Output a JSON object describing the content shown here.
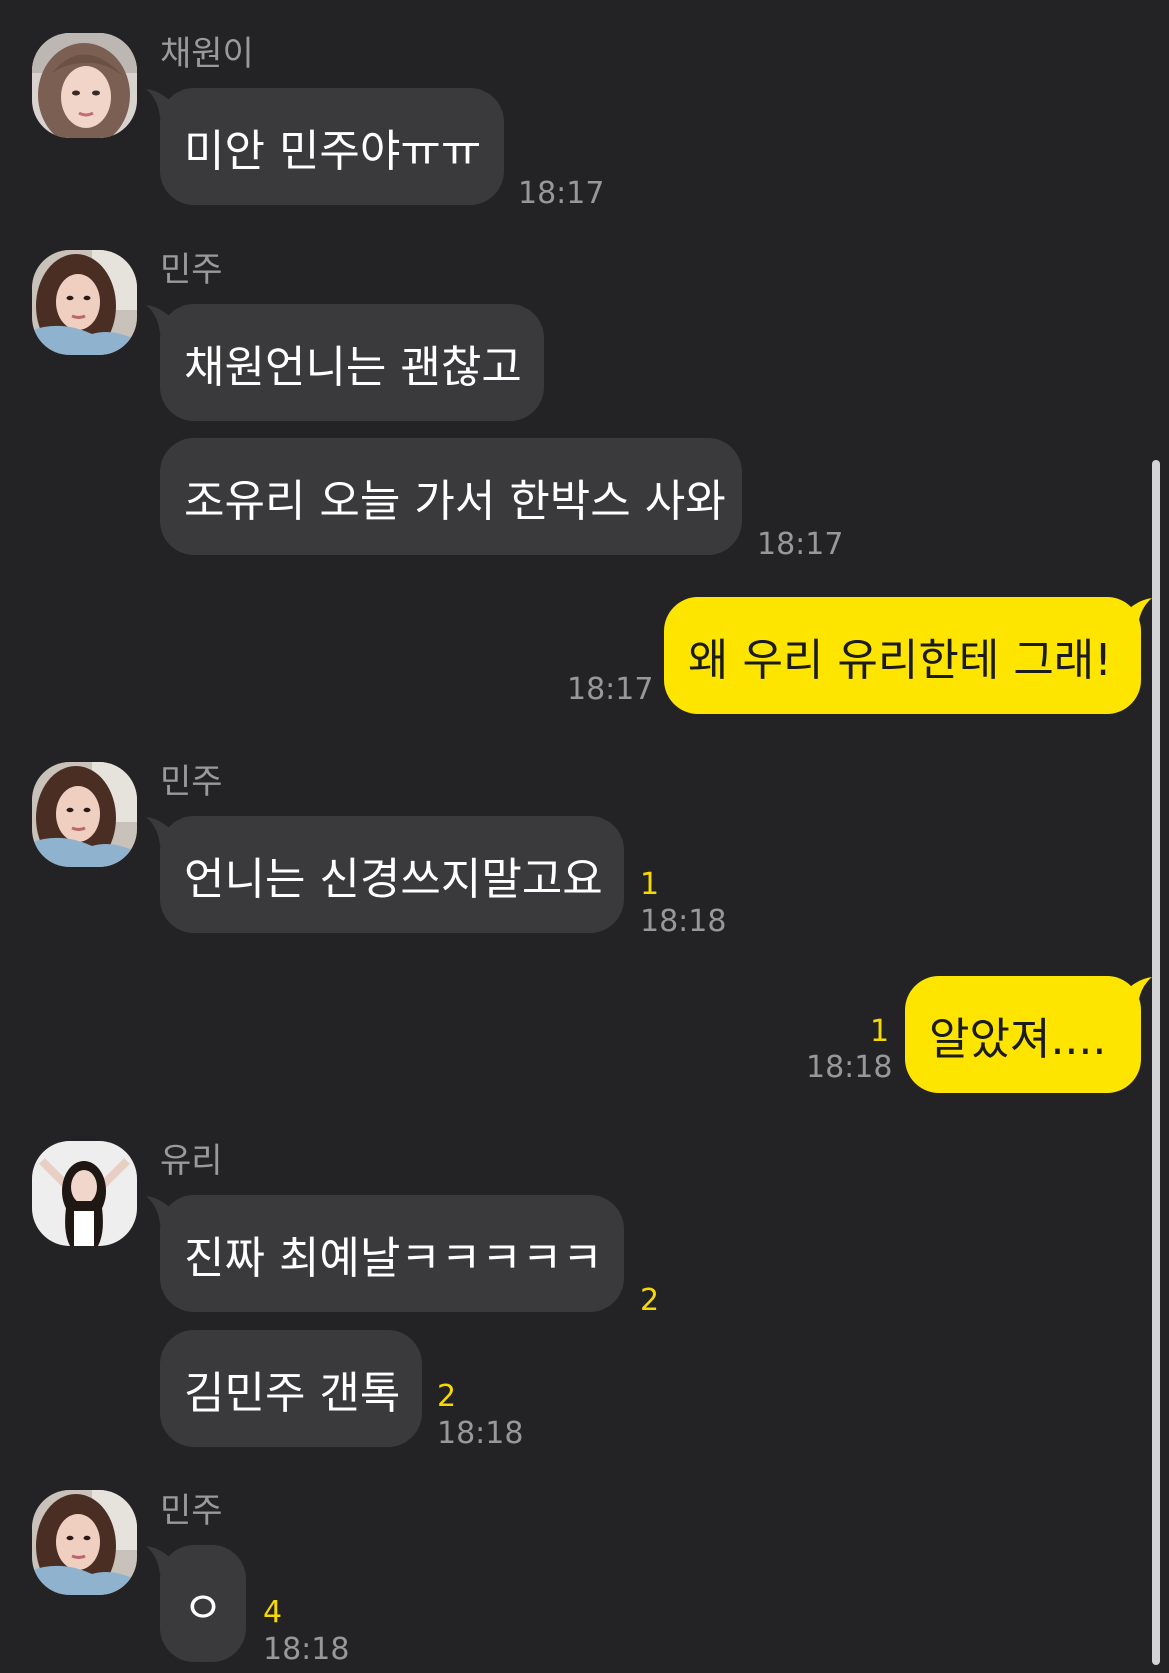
{
  "conversation": {
    "messages": [
      {
        "sender": "채원이",
        "text": "미안 민주야ㅠㅠ",
        "time": "18:17"
      },
      {
        "sender": "민주",
        "text": "채원언니는 괜찮고"
      },
      {
        "text": "조유리 오늘 가서 한박스 사와",
        "time": "18:17"
      },
      {
        "text": "왜 우리 유리한테 그래!",
        "time": "18:17"
      },
      {
        "sender": "민주",
        "text": "언니는 신경쓰지말고요",
        "unread": "1",
        "time": "18:18"
      },
      {
        "text": "알았져....",
        "unread": "1",
        "time": "18:18"
      },
      {
        "sender": "유리",
        "text": "진짜 최예날ㅋㅋㅋㅋㅋ",
        "unread": "2"
      },
      {
        "text": "김민주 갠톡",
        "unread": "2",
        "time": "18:18"
      },
      {
        "sender": "민주",
        "text": "ㅇ",
        "unread": "4",
        "time": "18:18"
      }
    ]
  },
  "colors": {
    "background": "#232325",
    "incoming_bubble": "#3a3a3c",
    "outgoing_bubble": "#fee500",
    "unread_count": "#f6d900",
    "time_text": "#98989a"
  },
  "icons": {
    "avatar_chaewon": "avatar-photo",
    "avatar_minju": "avatar-photo",
    "avatar_yuri": "avatar-photo"
  }
}
